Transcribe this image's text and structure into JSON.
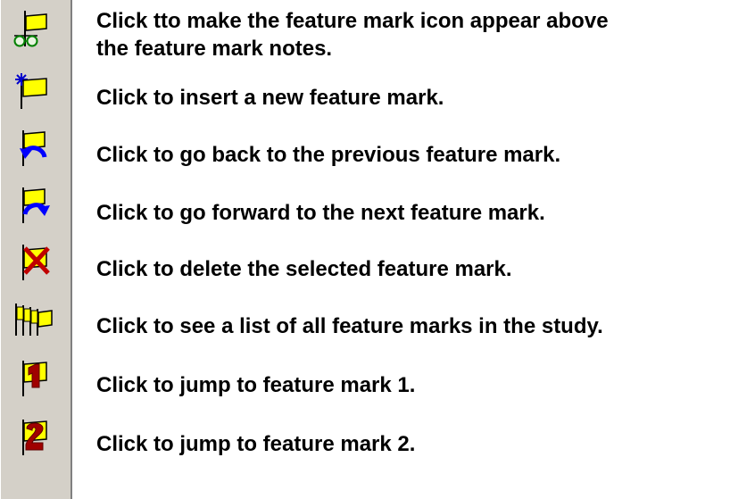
{
  "rows": [
    {
      "icon": "flag-with-glasses-icon",
      "label": "Click tto make the feature mark icon appear above\nthe feature mark notes."
    },
    {
      "icon": "insert-feature-mark-icon",
      "label": "Click to insert a new feature mark."
    },
    {
      "icon": "previous-feature-mark-icon",
      "label": "Click to go back to the previous feature mark."
    },
    {
      "icon": "next-feature-mark-icon",
      "label": "Click to go forward to the next feature mark."
    },
    {
      "icon": "delete-feature-mark-icon",
      "label": "Click to delete the selected feature mark."
    },
    {
      "icon": "feature-mark-list-icon",
      "label": "Click to see a list of all feature marks in the study."
    },
    {
      "icon": "feature-mark-1-icon",
      "label": "Click to jump to feature mark 1."
    },
    {
      "icon": "feature-mark-2-icon",
      "label": "Click to jump to feature mark 2."
    }
  ],
  "colors": {
    "flag_yellow": "#ffff00",
    "arrow_blue": "#0000ff",
    "delete_red": "#c00000",
    "number_red": "#a00000",
    "toolbar_gray": "#d4d0c8"
  }
}
